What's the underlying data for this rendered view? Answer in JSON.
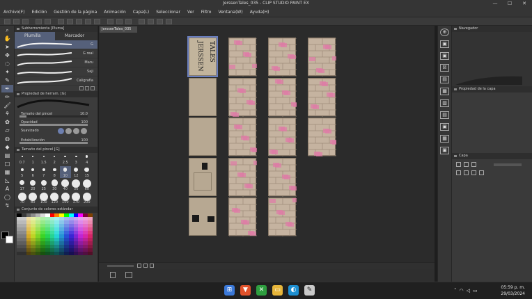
{
  "window": {
    "title": "JerssenTales_035 - CLIP STUDIO PAINT EX",
    "min": "—",
    "max": "☐",
    "close": "✕"
  },
  "menu": [
    "Archivo(F)",
    "Edición",
    "Gestión de la página",
    "Animación",
    "Capa(L)",
    "Seleccionar",
    "Ver",
    "Filtro",
    "Ventana(W)",
    "Ayuda(H)"
  ],
  "doc_tab": "JerssenTales_035",
  "left_panel": {
    "subtool_header": "Subherramienta [Pluma]",
    "tab_pen": "Plumilla",
    "tab_marker": "Marcador",
    "brushes": [
      {
        "label": "G",
        "selected": true
      },
      {
        "label": "G real",
        "selected": false
      },
      {
        "label": "Maru",
        "selected": false
      },
      {
        "label": "Saji",
        "selected": false
      },
      {
        "label": "Caligrafía",
        "selected": false
      }
    ],
    "tool_props_header": "Propiedad de herram. [G]",
    "brush_size_label": "Tamaño del pincel",
    "brush_size_value": "10.0",
    "brush_size_level": 0.1,
    "opacity_label": "Opacidad",
    "opacity_value": "100",
    "opacity_level": 1.0,
    "smoothing_label": "Suavizado",
    "stabilization_label": "Estabilización",
    "stabilization_value": "100",
    "stabilization_level": 1.0,
    "brush_size_header": "Tamaño del pincel [G]",
    "sizes": [
      "0.7",
      "1",
      "1.5",
      "2",
      "2.5",
      "3",
      "4",
      "5",
      "6",
      "7",
      "8",
      "10",
      "12",
      "15",
      "17",
      "20",
      "25",
      "30",
      "40",
      "50",
      "60",
      "70",
      "80",
      "100",
      "120",
      "150",
      "170",
      "200"
    ],
    "selected_size": "10",
    "color_header": "Conjunto de colores estándar"
  },
  "right_panel": {
    "navigator_header": "Navegador",
    "layer_props_header": "Propiedad de la capa",
    "layer_header": "Capa"
  },
  "taskbar": {
    "time": "05:59 p. m.",
    "date": "29/03/2024"
  },
  "tools": [
    {
      "icon": "zoom-icon",
      "glyph": "⌕"
    },
    {
      "icon": "hand-icon",
      "glyph": "✋"
    },
    {
      "icon": "operation-icon",
      "glyph": "➤"
    },
    {
      "icon": "move-icon",
      "glyph": "✥"
    },
    {
      "icon": "lasso-icon",
      "glyph": "◌"
    },
    {
      "icon": "magic-wand-icon",
      "glyph": "✦"
    },
    {
      "icon": "eyedropper-icon",
      "glyph": "✎"
    },
    {
      "icon": "pen-icon",
      "glyph": "✒"
    },
    {
      "icon": "pencil-icon",
      "glyph": "✏"
    },
    {
      "icon": "brush-icon",
      "glyph": "🖌"
    },
    {
      "icon": "airbrush-icon",
      "glyph": "⚘"
    },
    {
      "icon": "decoration-icon",
      "glyph": "✿"
    },
    {
      "icon": "eraser-icon",
      "glyph": "▱"
    },
    {
      "icon": "blend-icon",
      "glyph": "◍"
    },
    {
      "icon": "fill-icon",
      "glyph": "◆"
    },
    {
      "icon": "gradient-icon",
      "glyph": "▤"
    },
    {
      "icon": "figure-icon",
      "glyph": "□"
    },
    {
      "icon": "frame-icon",
      "glyph": "▦"
    },
    {
      "icon": "ruler-icon",
      "glyph": "◺"
    },
    {
      "icon": "text-icon",
      "glyph": "A"
    },
    {
      "icon": "balloon-icon",
      "glyph": "◯"
    },
    {
      "icon": "correct-line-icon",
      "glyph": "↯"
    }
  ],
  "colors": {
    "main": "#000000",
    "sub": "#ffffff",
    "accent": "#55607a"
  }
}
